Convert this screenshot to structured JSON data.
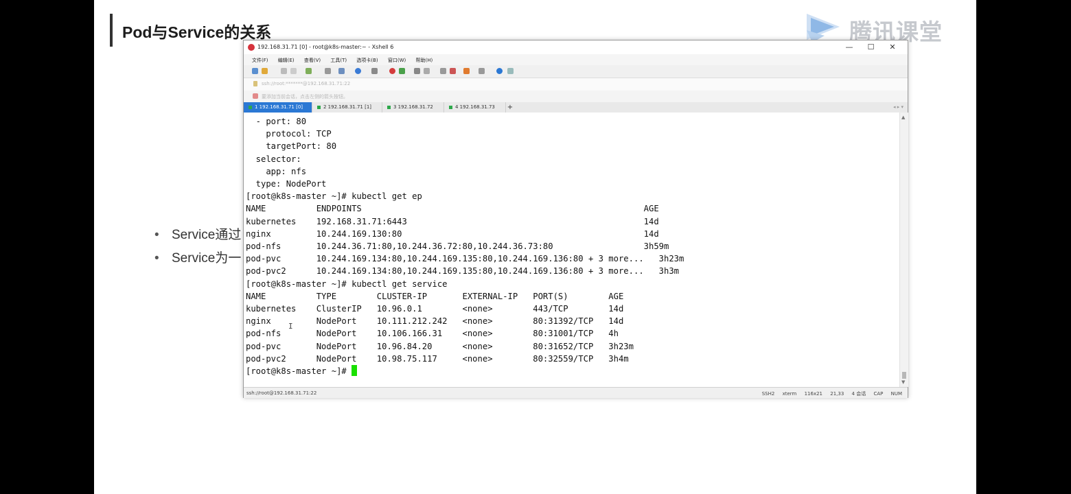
{
  "slide": {
    "title": "Pod与Service的关系",
    "logo_text": "腾讯课堂",
    "bullets": [
      "Service通过",
      "Service为一"
    ]
  },
  "window": {
    "title": "192.168.31.71 [0] - root@k8s-master:~ - Xshell 6",
    "controls": {
      "minimize": "—",
      "maximize": "☐",
      "close": "✕"
    },
    "menu": [
      "文件(F)",
      "编辑(E)",
      "查看(V)",
      "工具(T)",
      "选项卡(B)",
      "窗口(W)",
      "帮助(H)"
    ],
    "address": "ssh://root:*******@192.168.31.71:22",
    "hint": "要添加当前会话，点击左侧的箭头按钮。",
    "tabs": [
      {
        "label": "1 192.168.31.71 [0]",
        "active": true
      },
      {
        "label": "2 192.168.31.71 [1]",
        "active": false
      },
      {
        "label": "3 192.168.31.72",
        "active": false
      },
      {
        "label": "4 192.168.31.73",
        "active": false
      }
    ],
    "tab_add": "+",
    "status_left": "ssh://root@192.168.31.71:22",
    "status_right": [
      "SSH2",
      "xterm",
      "116x21",
      "21,33",
      "4 会话",
      "CAP",
      "NUM"
    ]
  },
  "terminal": {
    "lines": [
      "  - port: 80",
      "    protocol: TCP",
      "    targetPort: 80",
      "  selector:",
      "    app: nfs",
      "  type: NodePort",
      "[root@k8s-master ~]# kubectl get ep",
      "NAME          ENDPOINTS                                                        AGE",
      "kubernetes    192.168.31.71:6443                                               14d",
      "nginx         10.244.169.130:80                                                14d",
      "pod-nfs       10.244.36.71:80,10.244.36.72:80,10.244.36.73:80                  3h59m",
      "pod-pvc       10.244.169.134:80,10.244.169.135:80,10.244.169.136:80 + 3 more...   3h23m",
      "pod-pvc2      10.244.169.134:80,10.244.169.135:80,10.244.169.136:80 + 3 more...   3h3m",
      "[root@k8s-master ~]# kubectl get service",
      "NAME          TYPE        CLUSTER-IP       EXTERNAL-IP   PORT(S)        AGE",
      "kubernetes    ClusterIP   10.96.0.1        <none>        443/TCP        14d",
      "nginx         NodePort    10.111.212.242   <none>        80:31392/TCP   14d",
      "pod-nfs       NodePort    10.106.166.31    <none>        80:31001/TCP   4h",
      "pod-pvc       NodePort    10.96.84.20      <none>        80:31652/TCP   3h23m",
      "pod-pvc2      NodePort    10.98.75.117     <none>        80:32559/TCP   3h4m"
    ],
    "prompt": "[root@k8s-master ~]# "
  },
  "colors": {
    "tab_active": "#2b78d4",
    "cursor": "#19e000",
    "status_dot": "#2da84a"
  }
}
